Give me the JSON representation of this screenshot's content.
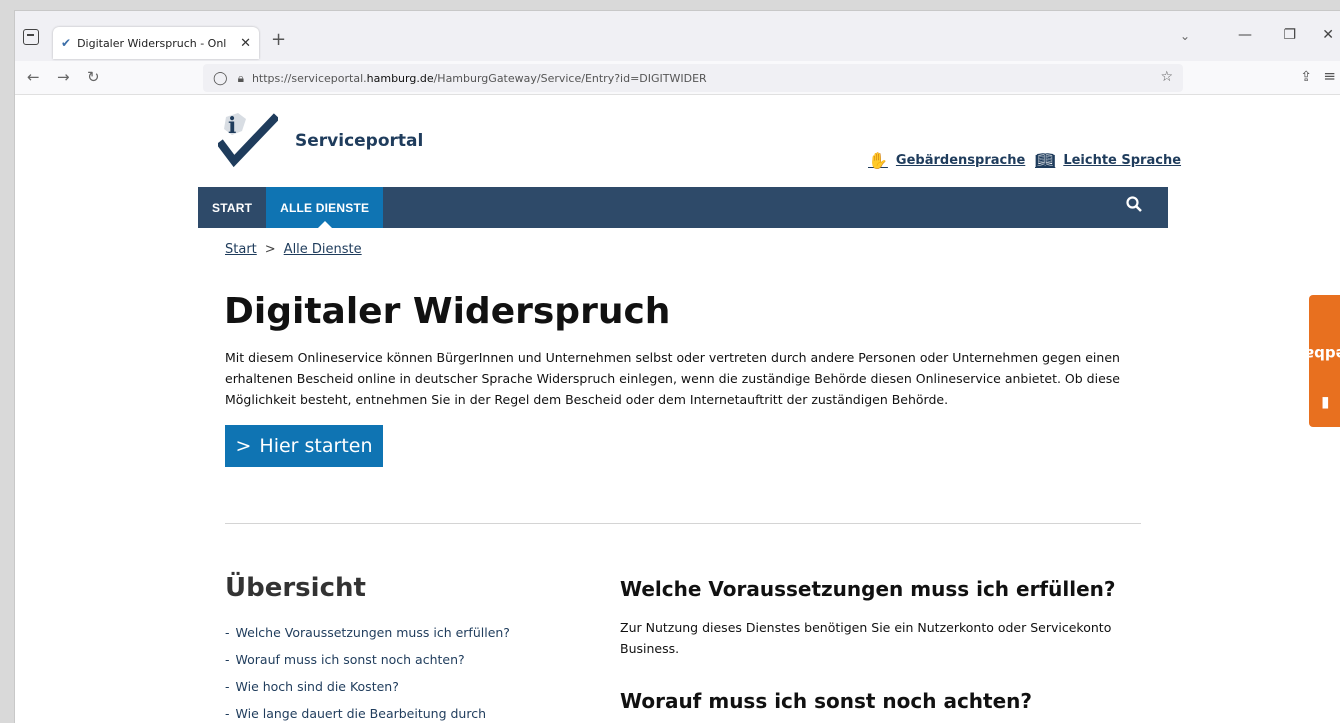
{
  "browser": {
    "tab_title": "Digitaler Widerspruch - Online-",
    "tab_close": "✕",
    "new_tab": "+",
    "url_prefix": "https://serviceportal.",
    "url_domain": "hamburg.de",
    "url_suffix": "/HamburgGateway/Service/Entry?id=DIGITWIDER"
  },
  "header": {
    "logo_text": "Serviceportal",
    "sign_language": "Gebärdensprache",
    "easy_language": "Leichte Sprache"
  },
  "nav": {
    "start": "START",
    "all_services": "ALLE DIENSTE"
  },
  "breadcrumb": {
    "start": "Start",
    "separator": ">",
    "current": "Alle Dienste"
  },
  "main": {
    "title": "Digitaler Widerspruch",
    "intro": "Mit diesem Onlineservice können BürgerInnen und Unternehmen selbst oder vertreten durch andere Personen oder Unternehmen gegen einen erhaltenen Bescheid online in deutscher Sprache Widerspruch einlegen, wenn die zuständige Behörde diesen Onlineservice anbietet. Ob diese Möglichkeit besteht, entnehmen Sie in der Regel dem Bescheid oder dem Internetauftritt der zuständigen Behörde.",
    "start_button": "Hier starten",
    "start_button_prefix": ">"
  },
  "overview": {
    "title": "Übersicht",
    "items": [
      "Welche Voraussetzungen muss ich erfüllen?",
      "Worauf muss ich sonst noch achten?",
      "Wie hoch sind die Kosten?",
      "Wie lange dauert die Bearbeitung durch"
    ]
  },
  "sections": {
    "requirements_title": "Welche Voraussetzungen muss ich erfüllen?",
    "requirements_text": "Zur Nutzung dieses Dienstes benötigen Sie ein Nutzerkonto oder Servicekonto Business.",
    "notes_title": "Worauf muss ich sonst noch achten?"
  },
  "feedback": {
    "label": "Feedback"
  },
  "colors": {
    "nav_bg": "#2e4a69",
    "accent_blue": "#0f74b3",
    "feedback_orange": "#e8701f"
  }
}
